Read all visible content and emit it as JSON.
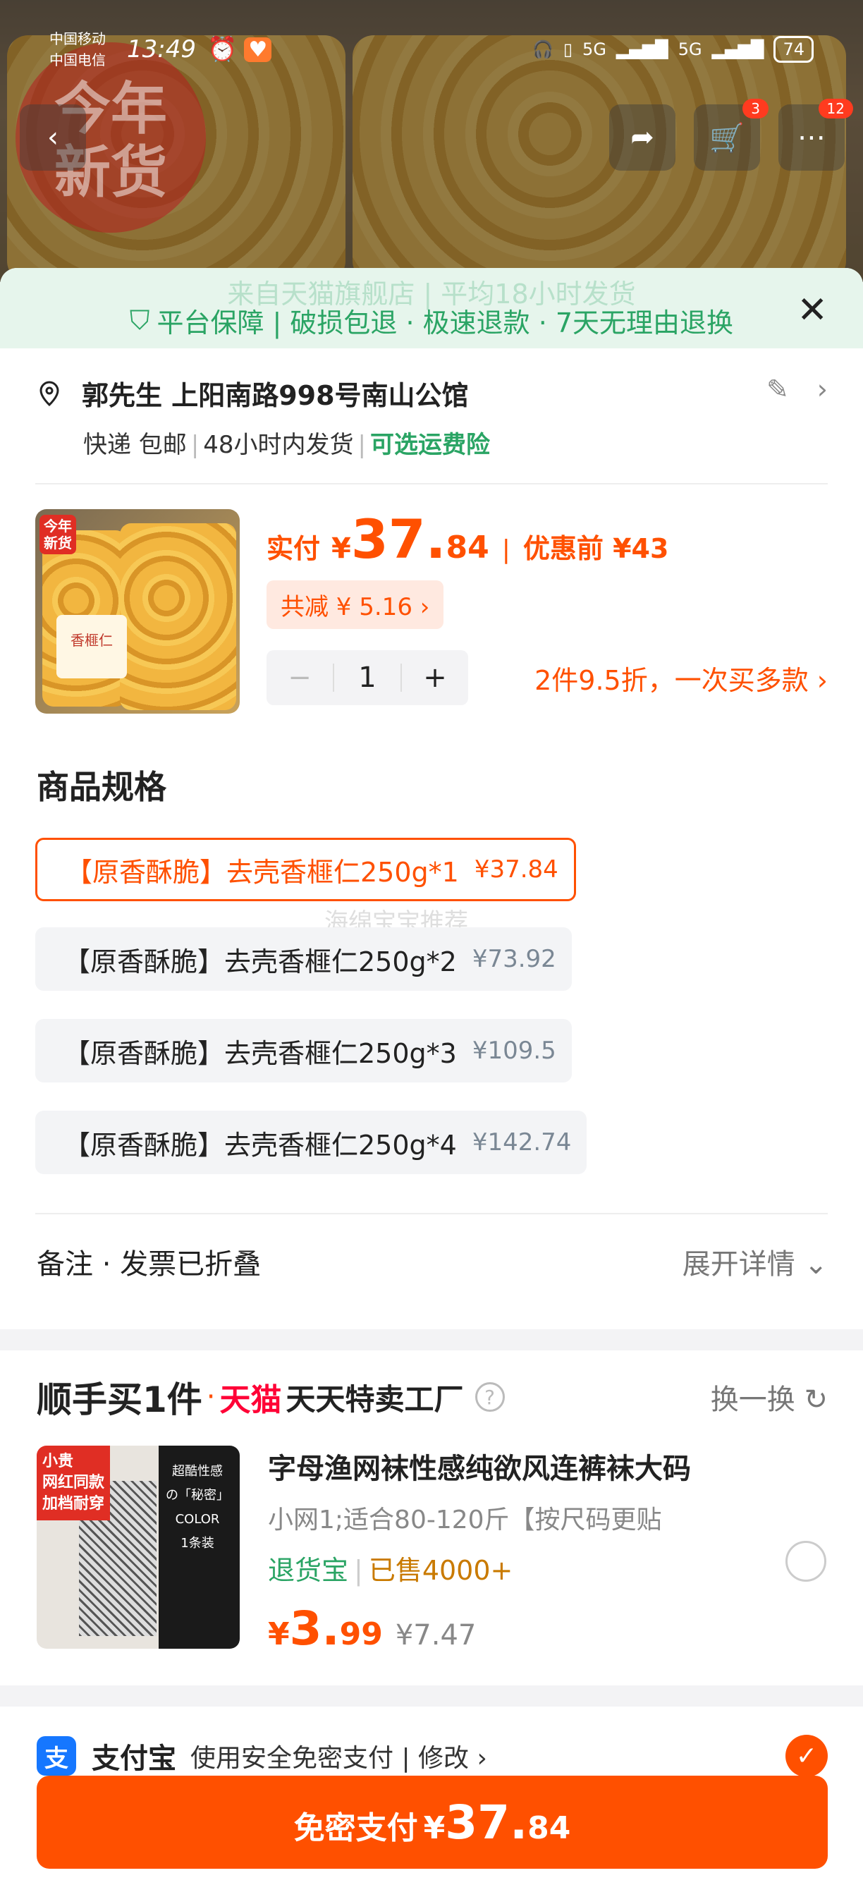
{
  "status_bar": {
    "carrier_1": "中国移动",
    "carrier_2": "中国电信",
    "time": "13:49",
    "network_1": "5G",
    "network_2": "5G",
    "battery": "74"
  },
  "header": {
    "logo_text_1": "今年",
    "logo_text_2": "新货",
    "cart_count": "3",
    "more_count": "12"
  },
  "guarantee": {
    "ghost_text": "来自天猫旗舰店 | 平均18小时发货",
    "text": "平台保障 | 破损包退 · 极速退款 · 7天无理由退换"
  },
  "address": {
    "line": "郭先生 上阳南路998号南山公馆",
    "delivery": "快递 包邮",
    "ship": "48小时内发货",
    "insurance": "可选运费险"
  },
  "product": {
    "tag_1": "今年",
    "tag_2": "新货",
    "label": "香榧仁",
    "pay_label": "实付",
    "pay_yen": "¥",
    "pay_int": "37.",
    "pay_dec": "84",
    "pre_label": "优惠前 ¥43",
    "reduce": "共减 ¥ 5.16 ›",
    "qty": "1",
    "multi": "2件9.5折，一次买多款"
  },
  "spec": {
    "title": "商品规格",
    "options": [
      {
        "label": "【原香酥脆】去壳香榧仁250g*1",
        "price": "¥37.84",
        "selected": true
      },
      {
        "label": "【原香酥脆】去壳香榧仁250g*2",
        "price": "¥73.92"
      },
      {
        "label": "【原香酥脆】去壳香榧仁250g*3",
        "price": "¥109.5"
      },
      {
        "label": "【原香酥脆】去壳香榧仁250g*4",
        "price": "¥142.74"
      }
    ],
    "ghost": "海绵宝宝推荐"
  },
  "notes": {
    "label": "备注 · 发票已折叠",
    "expand": "展开详情"
  },
  "add_on": {
    "title": "顺手买1件",
    "brand": "天猫",
    "sub": "天天特卖工厂",
    "swap": "换一换",
    "img_tag_1": "小贵",
    "img_tag_2": "网红同款",
    "img_tag_3": "加档耐穿",
    "img_side_1": "超酷性感",
    "img_side_2": "の「秘密」",
    "img_side_3": "COLOR",
    "img_side_4": "1条装",
    "name": "字母渔网袜性感纯欲风连裤袜大码",
    "spec": "小网1;适合80-120斤【按尺码更贴",
    "tag_return": "退货宝",
    "tag_sold": "已售4000+",
    "price_yen": "¥",
    "price_int": "3.",
    "price_dec": "99",
    "orig_price": "¥7.47"
  },
  "payment": {
    "method": "支付宝",
    "desc": "使用安全免密支付 | 修改 ›",
    "button_label": "免密支付",
    "button_yen": "¥",
    "button_int": "37.",
    "button_dec": "84"
  },
  "colors": {
    "accent": "#ff5000",
    "green": "#2aa464",
    "tmall_red": "#ff0036"
  }
}
